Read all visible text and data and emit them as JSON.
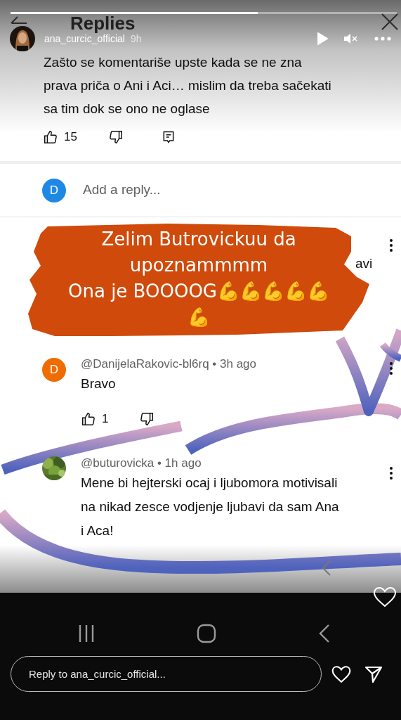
{
  "story": {
    "progress": {
      "level": 0.64
    },
    "author": "ana_curcic_official",
    "time": "9h",
    "reply_placeholder": "Reply to ana_curcic_official..."
  },
  "screenshot": {
    "title": "Replies",
    "comment": {
      "text_lines": [
        "Zašto se komentariše upste kada se ne zna",
        "prava priča o Ani i Aci… mislim da treba sačekati",
        "sa tim dok se ono ne oglase"
      ],
      "likes": "15"
    },
    "reply_field": {
      "avatar_letter": "D",
      "placeholder": "Add a reply..."
    },
    "covered_comment": {
      "visible_text": "avi"
    },
    "replies": [
      {
        "meta": "@DanijelaRakovic-bl6rq • 3h ago",
        "text_lines": [
          "Bravo"
        ],
        "likes": "1",
        "avatar": {
          "kind": "letter",
          "letter": "D",
          "color": "#ef6c00"
        }
      },
      {
        "meta": "@buturovicka • 1h ago",
        "text_lines": [
          "Mene bi hejterski ocaj i ljubomora motivisali",
          "na nikad zesce vodjenje ljubavi da sam Ana",
          "i Aca!"
        ],
        "avatar": {
          "kind": "picture"
        }
      }
    ]
  },
  "sticker": {
    "lines": [
      "Zelim Butrovickuu da",
      "upoznammmm",
      "Ona je BOOOOG💪💪💪💪💪",
      "💪"
    ]
  }
}
